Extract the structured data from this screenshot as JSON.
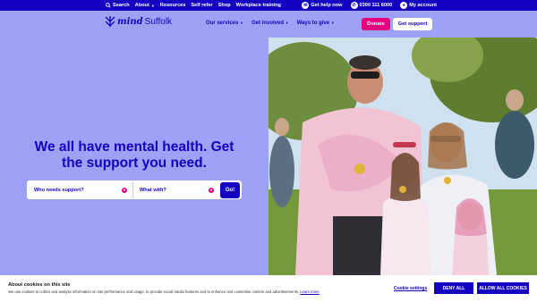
{
  "topbar": {
    "search": "Search",
    "about": "About",
    "resources": "Resources",
    "self_refer": "Self refer",
    "shop": "Shop",
    "workplace": "Workplace training",
    "help": "Get help now",
    "phone": "0300 111 6000",
    "account": "My account"
  },
  "header": {
    "logo_mind": "mind",
    "logo_region": "Suffolk",
    "nav": [
      "Our services",
      "Get involved",
      "Ways to give"
    ],
    "donate": "Donate",
    "get_support": "Get support"
  },
  "hero": {
    "title": "We all have mental health. Get the support you need."
  },
  "search": {
    "who": "Who needs support?",
    "what": "What with?",
    "go": "Go!"
  },
  "cookie": {
    "title": "About cookies on this site",
    "text": "We use cookies to collect and analyse information on site performance and usage, to provide social media features and to enhance and customise content and advertisements.",
    "learn_more": "Learn more",
    "settings": "Cookie settings",
    "deny": "DENY ALL",
    "allow": "ALLOW ALL COOKIES"
  },
  "colors": {
    "brand_blue": "#1300c1",
    "background": "#9ea2f7",
    "accent_pink": "#e6007e"
  }
}
